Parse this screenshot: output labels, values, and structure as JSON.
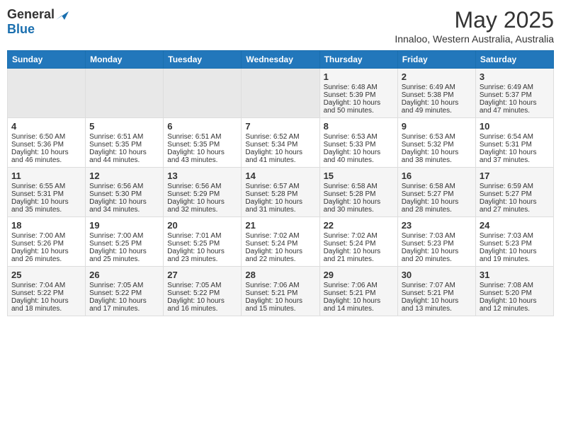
{
  "logo": {
    "general": "General",
    "blue": "Blue"
  },
  "title": "May 2025",
  "subtitle": "Innaloo, Western Australia, Australia",
  "headers": [
    "Sunday",
    "Monday",
    "Tuesday",
    "Wednesday",
    "Thursday",
    "Friday",
    "Saturday"
  ],
  "weeks": [
    [
      {
        "day": "",
        "sunrise": "",
        "sunset": "",
        "daylight": "",
        "empty": true
      },
      {
        "day": "",
        "sunrise": "",
        "sunset": "",
        "daylight": "",
        "empty": true
      },
      {
        "day": "",
        "sunrise": "",
        "sunset": "",
        "daylight": "",
        "empty": true
      },
      {
        "day": "",
        "sunrise": "",
        "sunset": "",
        "daylight": "",
        "empty": true
      },
      {
        "day": "1",
        "sunrise": "Sunrise: 6:48 AM",
        "sunset": "Sunset: 5:39 PM",
        "daylight": "Daylight: 10 hours and 50 minutes."
      },
      {
        "day": "2",
        "sunrise": "Sunrise: 6:49 AM",
        "sunset": "Sunset: 5:38 PM",
        "daylight": "Daylight: 10 hours and 49 minutes."
      },
      {
        "day": "3",
        "sunrise": "Sunrise: 6:49 AM",
        "sunset": "Sunset: 5:37 PM",
        "daylight": "Daylight: 10 hours and 47 minutes."
      }
    ],
    [
      {
        "day": "4",
        "sunrise": "Sunrise: 6:50 AM",
        "sunset": "Sunset: 5:36 PM",
        "daylight": "Daylight: 10 hours and 46 minutes."
      },
      {
        "day": "5",
        "sunrise": "Sunrise: 6:51 AM",
        "sunset": "Sunset: 5:35 PM",
        "daylight": "Daylight: 10 hours and 44 minutes."
      },
      {
        "day": "6",
        "sunrise": "Sunrise: 6:51 AM",
        "sunset": "Sunset: 5:35 PM",
        "daylight": "Daylight: 10 hours and 43 minutes."
      },
      {
        "day": "7",
        "sunrise": "Sunrise: 6:52 AM",
        "sunset": "Sunset: 5:34 PM",
        "daylight": "Daylight: 10 hours and 41 minutes."
      },
      {
        "day": "8",
        "sunrise": "Sunrise: 6:53 AM",
        "sunset": "Sunset: 5:33 PM",
        "daylight": "Daylight: 10 hours and 40 minutes."
      },
      {
        "day": "9",
        "sunrise": "Sunrise: 6:53 AM",
        "sunset": "Sunset: 5:32 PM",
        "daylight": "Daylight: 10 hours and 38 minutes."
      },
      {
        "day": "10",
        "sunrise": "Sunrise: 6:54 AM",
        "sunset": "Sunset: 5:31 PM",
        "daylight": "Daylight: 10 hours and 37 minutes."
      }
    ],
    [
      {
        "day": "11",
        "sunrise": "Sunrise: 6:55 AM",
        "sunset": "Sunset: 5:31 PM",
        "daylight": "Daylight: 10 hours and 35 minutes."
      },
      {
        "day": "12",
        "sunrise": "Sunrise: 6:56 AM",
        "sunset": "Sunset: 5:30 PM",
        "daylight": "Daylight: 10 hours and 34 minutes."
      },
      {
        "day": "13",
        "sunrise": "Sunrise: 6:56 AM",
        "sunset": "Sunset: 5:29 PM",
        "daylight": "Daylight: 10 hours and 32 minutes."
      },
      {
        "day": "14",
        "sunrise": "Sunrise: 6:57 AM",
        "sunset": "Sunset: 5:28 PM",
        "daylight": "Daylight: 10 hours and 31 minutes."
      },
      {
        "day": "15",
        "sunrise": "Sunrise: 6:58 AM",
        "sunset": "Sunset: 5:28 PM",
        "daylight": "Daylight: 10 hours and 30 minutes."
      },
      {
        "day": "16",
        "sunrise": "Sunrise: 6:58 AM",
        "sunset": "Sunset: 5:27 PM",
        "daylight": "Daylight: 10 hours and 28 minutes."
      },
      {
        "day": "17",
        "sunrise": "Sunrise: 6:59 AM",
        "sunset": "Sunset: 5:27 PM",
        "daylight": "Daylight: 10 hours and 27 minutes."
      }
    ],
    [
      {
        "day": "18",
        "sunrise": "Sunrise: 7:00 AM",
        "sunset": "Sunset: 5:26 PM",
        "daylight": "Daylight: 10 hours and 26 minutes."
      },
      {
        "day": "19",
        "sunrise": "Sunrise: 7:00 AM",
        "sunset": "Sunset: 5:25 PM",
        "daylight": "Daylight: 10 hours and 25 minutes."
      },
      {
        "day": "20",
        "sunrise": "Sunrise: 7:01 AM",
        "sunset": "Sunset: 5:25 PM",
        "daylight": "Daylight: 10 hours and 23 minutes."
      },
      {
        "day": "21",
        "sunrise": "Sunrise: 7:02 AM",
        "sunset": "Sunset: 5:24 PM",
        "daylight": "Daylight: 10 hours and 22 minutes."
      },
      {
        "day": "22",
        "sunrise": "Sunrise: 7:02 AM",
        "sunset": "Sunset: 5:24 PM",
        "daylight": "Daylight: 10 hours and 21 minutes."
      },
      {
        "day": "23",
        "sunrise": "Sunrise: 7:03 AM",
        "sunset": "Sunset: 5:23 PM",
        "daylight": "Daylight: 10 hours and 20 minutes."
      },
      {
        "day": "24",
        "sunrise": "Sunrise: 7:03 AM",
        "sunset": "Sunset: 5:23 PM",
        "daylight": "Daylight: 10 hours and 19 minutes."
      }
    ],
    [
      {
        "day": "25",
        "sunrise": "Sunrise: 7:04 AM",
        "sunset": "Sunset: 5:22 PM",
        "daylight": "Daylight: 10 hours and 18 minutes."
      },
      {
        "day": "26",
        "sunrise": "Sunrise: 7:05 AM",
        "sunset": "Sunset: 5:22 PM",
        "daylight": "Daylight: 10 hours and 17 minutes."
      },
      {
        "day": "27",
        "sunrise": "Sunrise: 7:05 AM",
        "sunset": "Sunset: 5:22 PM",
        "daylight": "Daylight: 10 hours and 16 minutes."
      },
      {
        "day": "28",
        "sunrise": "Sunrise: 7:06 AM",
        "sunset": "Sunset: 5:21 PM",
        "daylight": "Daylight: 10 hours and 15 minutes."
      },
      {
        "day": "29",
        "sunrise": "Sunrise: 7:06 AM",
        "sunset": "Sunset: 5:21 PM",
        "daylight": "Daylight: 10 hours and 14 minutes."
      },
      {
        "day": "30",
        "sunrise": "Sunrise: 7:07 AM",
        "sunset": "Sunset: 5:21 PM",
        "daylight": "Daylight: 10 hours and 13 minutes."
      },
      {
        "day": "31",
        "sunrise": "Sunrise: 7:08 AM",
        "sunset": "Sunset: 5:20 PM",
        "daylight": "Daylight: 10 hours and 12 minutes."
      }
    ]
  ]
}
